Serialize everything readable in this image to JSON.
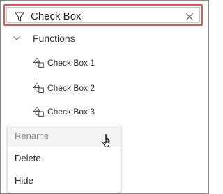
{
  "search": {
    "value": "Check Box",
    "filter_icon": "filter-icon",
    "clear_icon": "close-icon"
  },
  "tree": {
    "group_label": "Functions",
    "group_icon": "chevron-down-icon",
    "items": [
      {
        "label": "Check Box 1",
        "icon": "shapes-icon"
      },
      {
        "label": "Check Box 2",
        "icon": "shapes-icon"
      },
      {
        "label": "Check Box 3",
        "icon": "shapes-icon"
      }
    ]
  },
  "context_menu": {
    "items": [
      {
        "label": "Rename",
        "state": "disabled"
      },
      {
        "label": "Delete",
        "state": "enabled"
      },
      {
        "label": "Hide",
        "state": "enabled"
      }
    ]
  },
  "colors": {
    "highlight_border": "#e0584a",
    "text": "#242424",
    "disabled_text": "#8a8a8a"
  }
}
